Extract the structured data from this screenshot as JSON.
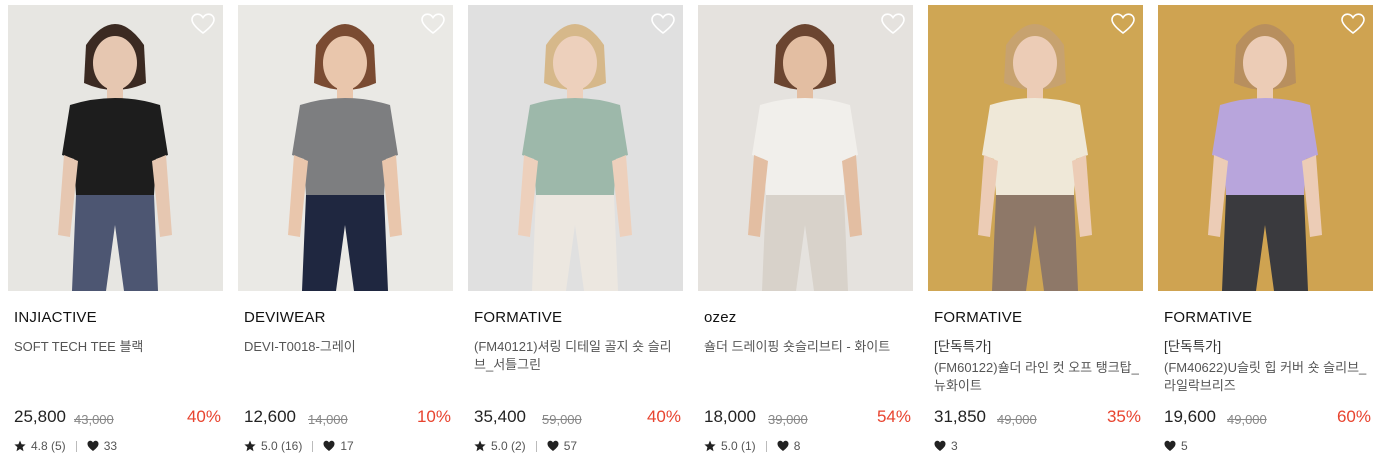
{
  "icons": {
    "wishlist": "heart-outline-icon",
    "rating": "star-icon",
    "likes": "heart-icon"
  },
  "colors": {
    "discount": "#e8442f",
    "text": "#222222",
    "muted": "#888888"
  },
  "products": [
    {
      "brand": "INJIACTIVE",
      "tag": "",
      "name": "SOFT TECH TEE 블랙",
      "price": "25,800",
      "original_price": "43,000",
      "discount": "40%",
      "rating": "4.8 (5)",
      "likes": "33",
      "photo": {
        "bg": "#e4e3df",
        "top": "#1d1d1d",
        "bottom": "#4d5672",
        "skin": "#e6c7b1",
        "hair": "#3b2a22"
      }
    },
    {
      "brand": "DEVIWEAR",
      "tag": "",
      "name": "DEVI-T0018-그레이",
      "price": "12,600",
      "original_price": "14,000",
      "discount": "10%",
      "rating": "5.0 (16)",
      "likes": "17",
      "photo": {
        "bg": "#e8e6e2",
        "top": "#7d7e80",
        "bottom": "#1f2740",
        "skin": "#e9c6ac",
        "hair": "#7a4b32"
      }
    },
    {
      "brand": "FORMATIVE",
      "tag": "",
      "name": "(FM40121)셔링 디테일 골지 숏 슬리브_서틀그린",
      "price": "35,400",
      "original_price": "59,000",
      "discount": "40%",
      "rating": "5.0 (2)",
      "likes": "57",
      "photo": {
        "bg": "#dcdcdc",
        "top": "#9db8aa",
        "bottom": "#ece7e0",
        "skin": "#edd0bc",
        "hair": "#d6b88a"
      }
    },
    {
      "brand": "ozez",
      "tag": "",
      "name": "숄더 드레이핑 숏슬리브티 - 화이트",
      "price": "18,000",
      "original_price": "39,000",
      "discount": "54%",
      "rating": "5.0 (1)",
      "likes": "8",
      "photo": {
        "bg": "#e2dfda",
        "top": "#f1efeb",
        "bottom": "#d8d2ca",
        "skin": "#e3bea2",
        "hair": "#6b4530"
      }
    },
    {
      "brand": "FORMATIVE",
      "tag": "[단독특가]",
      "name": "(FM60122)숄더 라인 컷 오프 탱크탑_뉴화이트",
      "price": "31,850",
      "original_price": "49,000",
      "discount": "35%",
      "rating": "",
      "likes": "3",
      "photo": {
        "bg": "#c99a3d",
        "top": "#efe8d8",
        "bottom": "#8e7868",
        "skin": "#ecccb6",
        "hair": "#c7a26f"
      }
    },
    {
      "brand": "FORMATIVE",
      "tag": "[단독특가]",
      "name": "(FM40622)U슬릿 힙 커버 숏 슬리브_라일락브리즈",
      "price": "19,600",
      "original_price": "49,000",
      "discount": "60%",
      "rating": "",
      "likes": "5",
      "photo": {
        "bg": "#c9973a",
        "top": "#b8a5dc",
        "bottom": "#3a3a3e",
        "skin": "#ecccb6",
        "hair": "#b88f5e"
      }
    }
  ]
}
